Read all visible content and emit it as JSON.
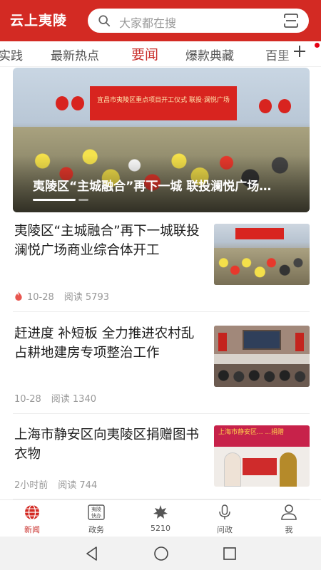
{
  "header": {
    "app_title": "云上夷陵",
    "search_placeholder": "大家都在搜",
    "brand_color": "#d32a23"
  },
  "tabs": [
    {
      "label": "实践",
      "active": false
    },
    {
      "label": "最新热点",
      "active": false
    },
    {
      "label": "要闻",
      "active": true
    },
    {
      "label": "爆款典藏",
      "active": false
    },
    {
      "label": "百里",
      "active": false
    }
  ],
  "hero": {
    "title": "夷陵区“主城融合”再下一城 联投澜悦广场商业综合体开工",
    "stage_text": "宜昌市夷陵区重点项目开工仪式 联投·澜悦广场"
  },
  "articles": [
    {
      "title": "夷陵区“主城融合”再下一城联投澜悦广场商业综合体开工",
      "hot": true,
      "date": "10-28",
      "read_label": "阅读 5793"
    },
    {
      "title": "赶进度 补短板 全力推进农村乱占耕地建房专项整治工作",
      "hot": false,
      "date": "10-28",
      "read_label": "阅读 1340"
    },
    {
      "title": "上海市静安区向夷陵区捐赠图书衣物",
      "hot": false,
      "date": "2小时前",
      "read_label": "阅读 744"
    }
  ],
  "thumb3_banner": "上海市静安区...\n...捐赠",
  "bottom_nav": [
    {
      "label": "新闻",
      "icon": "globe-icon",
      "active": true
    },
    {
      "label": "政务",
      "icon": "kuaixun-icon",
      "active": false
    },
    {
      "label": "5210",
      "icon": "leaf-icon",
      "active": false
    },
    {
      "label": "问政",
      "icon": "microphone-icon",
      "active": false
    },
    {
      "label": "我",
      "icon": "user-icon",
      "active": false
    }
  ],
  "kuaixun_icon_text": "夷陵快办"
}
